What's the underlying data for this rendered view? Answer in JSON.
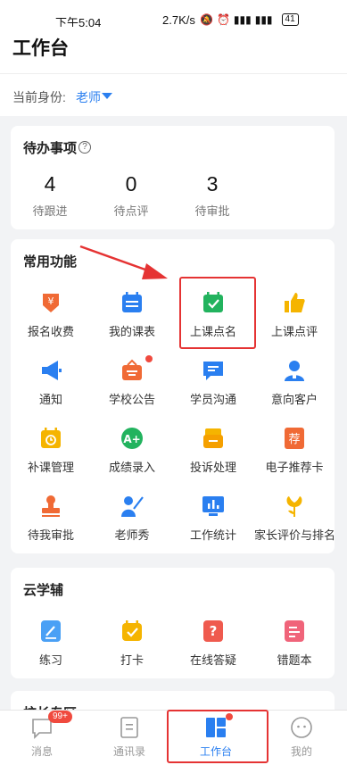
{
  "status_bar": {
    "time": "下午5:04",
    "network_speed": "2.7K/s",
    "battery": "41"
  },
  "header": {
    "title": "工作台"
  },
  "identity": {
    "label": "当前身份:",
    "value": "老师"
  },
  "todo": {
    "title": "待办事项",
    "stats": [
      {
        "value": "4",
        "label": "待跟进"
      },
      {
        "value": "0",
        "label": "待点评"
      },
      {
        "value": "3",
        "label": "待审批"
      }
    ]
  },
  "functions": {
    "title": "常用功能",
    "items": [
      {
        "label": "报名收费",
        "icon": "yuan-flag-icon"
      },
      {
        "label": "我的课表",
        "icon": "schedule-icon"
      },
      {
        "label": "上课点名",
        "icon": "calendar-check-icon"
      },
      {
        "label": "上课点评",
        "icon": "thumbs-up-icon"
      },
      {
        "label": "通知",
        "icon": "megaphone-icon"
      },
      {
        "label": "学校公告",
        "icon": "announcement-icon"
      },
      {
        "label": "学员沟通",
        "icon": "chat-icon"
      },
      {
        "label": "意向客户",
        "icon": "customer-icon"
      },
      {
        "label": "补课管理",
        "icon": "makeup-calendar-icon"
      },
      {
        "label": "成绩录入",
        "icon": "grade-icon"
      },
      {
        "label": "投诉处理",
        "icon": "complaint-folder-icon"
      },
      {
        "label": "电子推荐卡",
        "icon": "recommend-card-icon"
      },
      {
        "label": "待我审批",
        "icon": "stamp-icon"
      },
      {
        "label": "老师秀",
        "icon": "teacher-icon"
      },
      {
        "label": "工作统计",
        "icon": "stats-icon"
      },
      {
        "label": "家长评价与排名",
        "icon": "flower-icon"
      }
    ]
  },
  "cloud": {
    "title": "云学辅",
    "items": [
      {
        "label": "练习",
        "icon": "practice-icon"
      },
      {
        "label": "打卡",
        "icon": "checkin-icon"
      },
      {
        "label": "在线答疑",
        "icon": "question-icon"
      },
      {
        "label": "错题本",
        "icon": "mistake-book-icon"
      }
    ]
  },
  "principal": {
    "title": "校长专区"
  },
  "tabbar": {
    "items": [
      {
        "label": "消息",
        "badge": "99+"
      },
      {
        "label": "通讯录"
      },
      {
        "label": "工作台"
      },
      {
        "label": "我的"
      }
    ]
  },
  "colors": {
    "accent": "#2a7ff0",
    "highlight": "#e53333",
    "badge": "#f04a3e"
  }
}
